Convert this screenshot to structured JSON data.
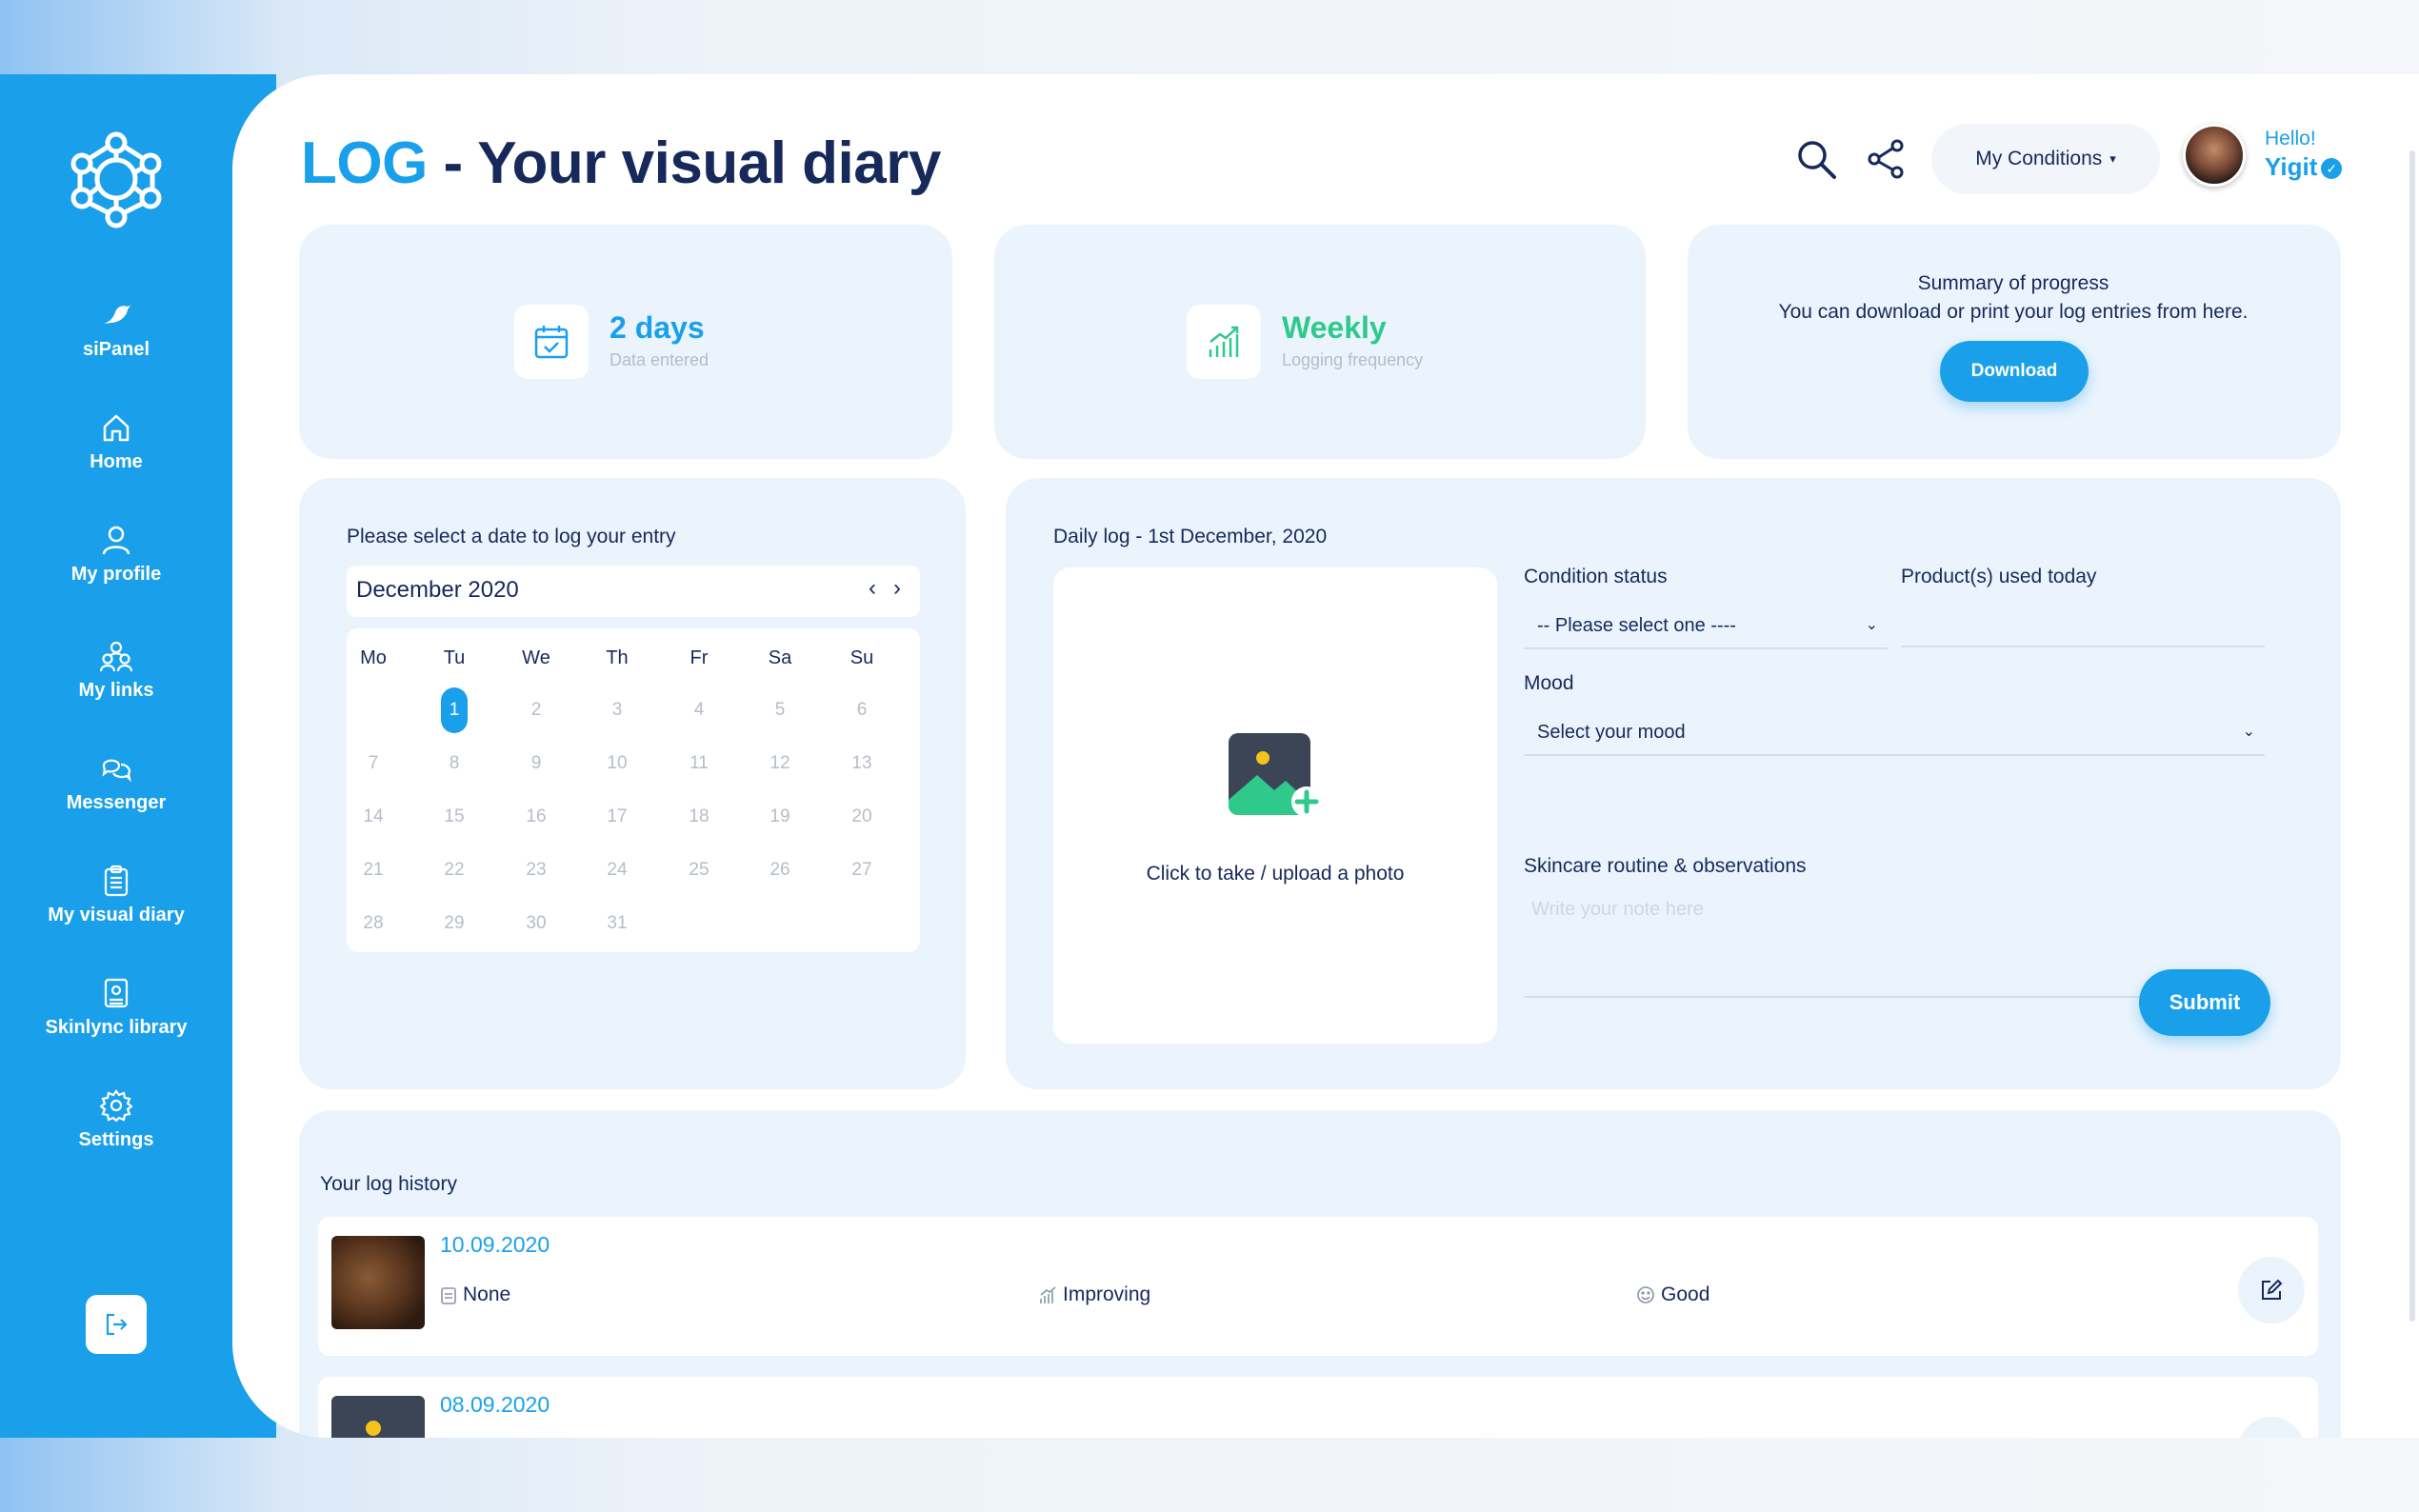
{
  "sidebar": {
    "items": [
      {
        "label": "siPanel",
        "icon": "bird-icon"
      },
      {
        "label": "Home",
        "icon": "home-icon"
      },
      {
        "label": "My profile",
        "icon": "user-icon"
      },
      {
        "label": "My links",
        "icon": "users-icon"
      },
      {
        "label": "Messenger",
        "icon": "chat-icon"
      },
      {
        "label": "My visual diary",
        "icon": "clipboard-icon"
      },
      {
        "label": "Skinlync library",
        "icon": "library-icon"
      },
      {
        "label": "Settings",
        "icon": "gear-icon"
      }
    ]
  },
  "header": {
    "title_accent": "LOG",
    "title_rest": " - Your visual diary",
    "conditions_label": "My Conditions",
    "hello": "Hello!",
    "user": "Yigit"
  },
  "stats": {
    "days_value": "2 days",
    "days_label": "Data entered",
    "freq_value": "Weekly",
    "freq_label": "Logging frequency",
    "summary_title": "Summary of progress",
    "summary_desc": "You can download or print your log entries from here.",
    "download_label": "Download"
  },
  "calendar": {
    "prompt": "Please select a date to log your entry",
    "month": "December 2020",
    "weekdays": [
      "Mo",
      "Tu",
      "We",
      "Th",
      "Fr",
      "Sa",
      "Su"
    ],
    "days": [
      "1",
      "2",
      "3",
      "4",
      "5",
      "6",
      "7",
      "8",
      "9",
      "10",
      "11",
      "12",
      "13",
      "14",
      "15",
      "16",
      "17",
      "18",
      "19",
      "20",
      "21",
      "22",
      "23",
      "24",
      "25",
      "26",
      "27",
      "28",
      "29",
      "30",
      "31"
    ],
    "selected_day": "1"
  },
  "daily_log": {
    "title": "Daily log - 1st December, 2020",
    "photo_caption": "Click to take / upload a photo",
    "condition_label": "Condition status",
    "condition_value": "-- Please select one ----",
    "products_label": "Product(s) used today",
    "mood_label": "Mood",
    "mood_value": "Select your mood",
    "notes_label": "Skincare routine & observations",
    "notes_placeholder": "Write your note here",
    "submit_label": "Submit"
  },
  "history": {
    "title": "Your log history",
    "entries": [
      {
        "date": "10.09.2020",
        "product": "None",
        "status": "Improving",
        "mood": "Good"
      },
      {
        "date": "08.09.2020"
      }
    ]
  },
  "colors": {
    "accent": "#1aa0ea",
    "green": "#2ec98b",
    "navy": "#16295a",
    "card_bg": "#ebf4fd"
  }
}
